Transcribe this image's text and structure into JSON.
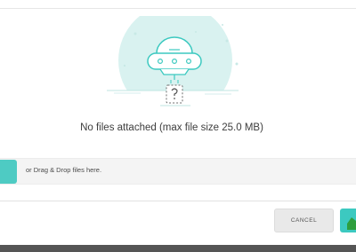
{
  "empty_state": {
    "message": "No files attached (max file size 25.0 MB)",
    "illustration_icon": "ufo-unknown-file-icon"
  },
  "upload": {
    "drop_hint": "or Drag & Drop files here.",
    "browse_icon": "upload-icon"
  },
  "footer": {
    "cancel_label": "CANCEL",
    "confirm_icon": "check-icon"
  },
  "colors": {
    "accent": "#3cc9c0",
    "accent_light": "#d5f1ef",
    "text": "#3d3d3d",
    "bar_background": "#f4f4f4"
  }
}
